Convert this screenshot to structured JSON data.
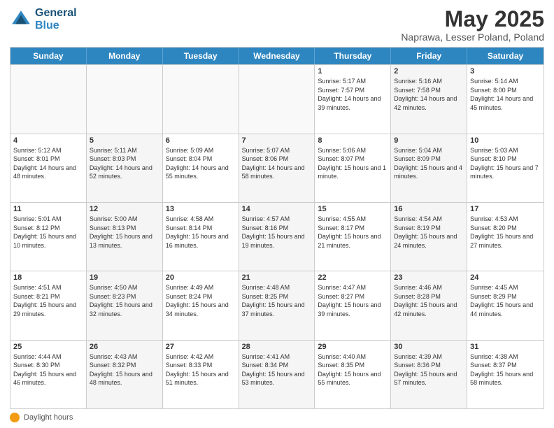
{
  "header": {
    "logo_line1": "General",
    "logo_line2": "Blue",
    "title": "May 2025",
    "subtitle": "Naprawa, Lesser Poland, Poland"
  },
  "days": [
    "Sunday",
    "Monday",
    "Tuesday",
    "Wednesday",
    "Thursday",
    "Friday",
    "Saturday"
  ],
  "weeks": [
    [
      {
        "day": "",
        "info": ""
      },
      {
        "day": "",
        "info": ""
      },
      {
        "day": "",
        "info": ""
      },
      {
        "day": "",
        "info": ""
      },
      {
        "day": "1",
        "info": "Sunrise: 5:17 AM\nSunset: 7:57 PM\nDaylight: 14 hours\nand 39 minutes."
      },
      {
        "day": "2",
        "info": "Sunrise: 5:16 AM\nSunset: 7:58 PM\nDaylight: 14 hours\nand 42 minutes."
      },
      {
        "day": "3",
        "info": "Sunrise: 5:14 AM\nSunset: 8:00 PM\nDaylight: 14 hours\nand 45 minutes."
      }
    ],
    [
      {
        "day": "4",
        "info": "Sunrise: 5:12 AM\nSunset: 8:01 PM\nDaylight: 14 hours\nand 48 minutes."
      },
      {
        "day": "5",
        "info": "Sunrise: 5:11 AM\nSunset: 8:03 PM\nDaylight: 14 hours\nand 52 minutes."
      },
      {
        "day": "6",
        "info": "Sunrise: 5:09 AM\nSunset: 8:04 PM\nDaylight: 14 hours\nand 55 minutes."
      },
      {
        "day": "7",
        "info": "Sunrise: 5:07 AM\nSunset: 8:06 PM\nDaylight: 14 hours\nand 58 minutes."
      },
      {
        "day": "8",
        "info": "Sunrise: 5:06 AM\nSunset: 8:07 PM\nDaylight: 15 hours\nand 1 minute."
      },
      {
        "day": "9",
        "info": "Sunrise: 5:04 AM\nSunset: 8:09 PM\nDaylight: 15 hours\nand 4 minutes."
      },
      {
        "day": "10",
        "info": "Sunrise: 5:03 AM\nSunset: 8:10 PM\nDaylight: 15 hours\nand 7 minutes."
      }
    ],
    [
      {
        "day": "11",
        "info": "Sunrise: 5:01 AM\nSunset: 8:12 PM\nDaylight: 15 hours\nand 10 minutes."
      },
      {
        "day": "12",
        "info": "Sunrise: 5:00 AM\nSunset: 8:13 PM\nDaylight: 15 hours\nand 13 minutes."
      },
      {
        "day": "13",
        "info": "Sunrise: 4:58 AM\nSunset: 8:14 PM\nDaylight: 15 hours\nand 16 minutes."
      },
      {
        "day": "14",
        "info": "Sunrise: 4:57 AM\nSunset: 8:16 PM\nDaylight: 15 hours\nand 19 minutes."
      },
      {
        "day": "15",
        "info": "Sunrise: 4:55 AM\nSunset: 8:17 PM\nDaylight: 15 hours\nand 21 minutes."
      },
      {
        "day": "16",
        "info": "Sunrise: 4:54 AM\nSunset: 8:19 PM\nDaylight: 15 hours\nand 24 minutes."
      },
      {
        "day": "17",
        "info": "Sunrise: 4:53 AM\nSunset: 8:20 PM\nDaylight: 15 hours\nand 27 minutes."
      }
    ],
    [
      {
        "day": "18",
        "info": "Sunrise: 4:51 AM\nSunset: 8:21 PM\nDaylight: 15 hours\nand 29 minutes."
      },
      {
        "day": "19",
        "info": "Sunrise: 4:50 AM\nSunset: 8:23 PM\nDaylight: 15 hours\nand 32 minutes."
      },
      {
        "day": "20",
        "info": "Sunrise: 4:49 AM\nSunset: 8:24 PM\nDaylight: 15 hours\nand 34 minutes."
      },
      {
        "day": "21",
        "info": "Sunrise: 4:48 AM\nSunset: 8:25 PM\nDaylight: 15 hours\nand 37 minutes."
      },
      {
        "day": "22",
        "info": "Sunrise: 4:47 AM\nSunset: 8:27 PM\nDaylight: 15 hours\nand 39 minutes."
      },
      {
        "day": "23",
        "info": "Sunrise: 4:46 AM\nSunset: 8:28 PM\nDaylight: 15 hours\nand 42 minutes."
      },
      {
        "day": "24",
        "info": "Sunrise: 4:45 AM\nSunset: 8:29 PM\nDaylight: 15 hours\nand 44 minutes."
      }
    ],
    [
      {
        "day": "25",
        "info": "Sunrise: 4:44 AM\nSunset: 8:30 PM\nDaylight: 15 hours\nand 46 minutes."
      },
      {
        "day": "26",
        "info": "Sunrise: 4:43 AM\nSunset: 8:32 PM\nDaylight: 15 hours\nand 48 minutes."
      },
      {
        "day": "27",
        "info": "Sunrise: 4:42 AM\nSunset: 8:33 PM\nDaylight: 15 hours\nand 51 minutes."
      },
      {
        "day": "28",
        "info": "Sunrise: 4:41 AM\nSunset: 8:34 PM\nDaylight: 15 hours\nand 53 minutes."
      },
      {
        "day": "29",
        "info": "Sunrise: 4:40 AM\nSunset: 8:35 PM\nDaylight: 15 hours\nand 55 minutes."
      },
      {
        "day": "30",
        "info": "Sunrise: 4:39 AM\nSunset: 8:36 PM\nDaylight: 15 hours\nand 57 minutes."
      },
      {
        "day": "31",
        "info": "Sunrise: 4:38 AM\nSunset: 8:37 PM\nDaylight: 15 hours\nand 58 minutes."
      }
    ]
  ],
  "footer": {
    "daylight_hours_label": "Daylight hours"
  }
}
